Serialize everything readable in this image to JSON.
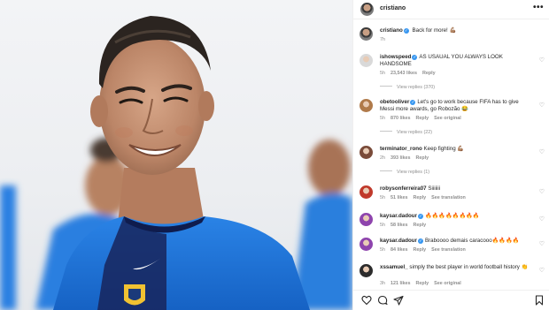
{
  "post": {
    "author": "cristiano",
    "caption": "Back for more! 💪🏽",
    "caption_time": "7h"
  },
  "comments": [
    {
      "user": "ishowspeed",
      "verified": true,
      "text": "AS USAUAL YOU ALWAYS LOOK HANDSOME",
      "time": "5h",
      "likes": "23,543 likes",
      "reply": "Reply",
      "extra": "",
      "view_replies": "View replies (370)",
      "avatar_color": "#d9d9d9"
    },
    {
      "user": "obetooliver",
      "verified": true,
      "text": "Let's go to work because FIFA has to give Messi more awards, go Robozão 😂",
      "time": "5h",
      "likes": "870 likes",
      "reply": "Reply",
      "extra": "See original",
      "view_replies": "View replies (22)",
      "avatar_color": "#b07a4a"
    },
    {
      "user": "terminator_rono",
      "verified": false,
      "text": "Keep fighting 💪🏽",
      "time": "2h",
      "likes": "393 likes",
      "reply": "Reply",
      "extra": "",
      "view_replies": "View replies (1)",
      "avatar_color": "#7a4b3a"
    },
    {
      "user": "robysonferreira07",
      "verified": false,
      "text": "Siiiiiii",
      "time": "5h",
      "likes": "51 likes",
      "reply": "Reply",
      "extra": "See translation",
      "view_replies": "",
      "avatar_color": "#c0392b"
    },
    {
      "user": "kaysar.dadour",
      "verified": true,
      "text": "🔥🔥🔥🔥🔥🔥🔥🔥",
      "time": "5h",
      "likes": "58 likes",
      "reply": "Reply",
      "extra": "",
      "view_replies": "",
      "avatar_color": "#8e44ad"
    },
    {
      "user": "kaysar.dadour",
      "verified": true,
      "text": "Braboooo demais caracooo🔥🔥🔥🔥",
      "time": "5h",
      "likes": "84 likes",
      "reply": "Reply",
      "extra": "See translation",
      "view_replies": "",
      "avatar_color": "#8e44ad"
    },
    {
      "user": "xssamuel_",
      "verified": false,
      "text": "simply the best player in world football history 👏",
      "time": "3h",
      "likes": "121 likes",
      "reply": "Reply",
      "extra": "See original",
      "view_replies": "",
      "avatar_color": "#2c2c2c"
    }
  ],
  "icons": {
    "more": "more-options-icon",
    "like": "heart-icon",
    "comment": "comment-icon",
    "share": "share-icon",
    "save": "bookmark-icon"
  },
  "colors": {
    "verified": "#3897f0",
    "muted_text": "#8e8e8e",
    "jersey_blue": "#1a6fd4",
    "jersey_navy": "#17255c"
  }
}
